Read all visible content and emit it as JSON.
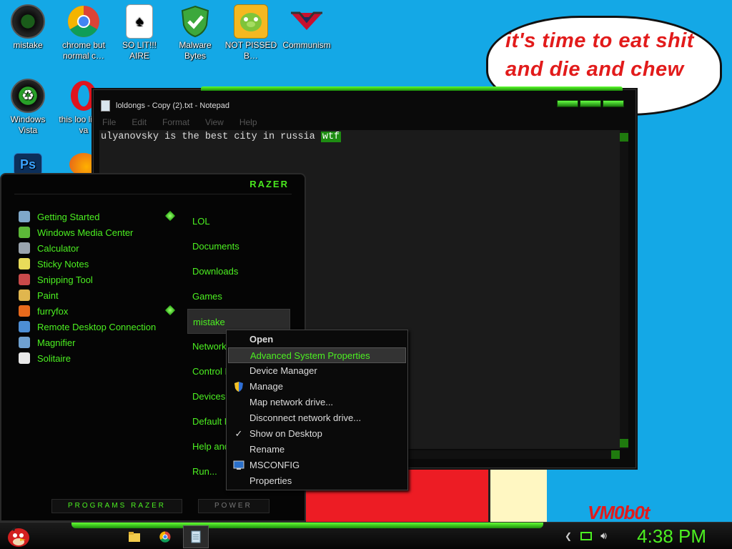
{
  "desktop_icons": [
    {
      "label": "mistake",
      "icon": "razer-icon"
    },
    {
      "label": "chrome but normal c…",
      "icon": "chrome-icon"
    },
    {
      "label": "SO LIT!!! AIRE",
      "icon": "solitaire-icon"
    },
    {
      "label": "Malware Bytes",
      "icon": "shield-icon"
    },
    {
      "label": "NOT PISSED B…",
      "icon": "angry-birds-pig-icon"
    },
    {
      "label": "Communism",
      "icon": "red-emblem-icon"
    },
    {
      "label": "Windows Vista",
      "icon": "recycle-icon"
    },
    {
      "label": "this loo like a va",
      "icon": "opera-icon"
    }
  ],
  "bubble": {
    "text": "it's time to eat shit and die and chew"
  },
  "watermark": "VM0b0t",
  "notepad": {
    "title": "loldongs - Copy (2).txt - Notepad",
    "menu": [
      "File",
      "Edit",
      "Format",
      "View",
      "Help"
    ],
    "text_before": "ulyanovsky is the best city in russia ",
    "text_selected": "wtf"
  },
  "start_menu": {
    "logo": "RAZER",
    "programs": [
      {
        "label": "Getting Started",
        "color": "#7fa8c9",
        "has_arrow": true
      },
      {
        "label": "Windows Media Center",
        "color": "#5cb838",
        "has_arrow": false
      },
      {
        "label": "Calculator",
        "color": "#9aa4ae",
        "has_arrow": false
      },
      {
        "label": "Sticky Notes",
        "color": "#e8dc5a",
        "has_arrow": false
      },
      {
        "label": "Snipping Tool",
        "color": "#c94a4a",
        "has_arrow": false
      },
      {
        "label": "Paint",
        "color": "#e0b64e",
        "has_arrow": false
      },
      {
        "label": "furryfox",
        "color": "#e86a1c",
        "has_arrow": true
      },
      {
        "label": "Remote Desktop Connection",
        "color": "#4d8ed4",
        "has_arrow": false
      },
      {
        "label": "Magnifier",
        "color": "#6fa0d0",
        "has_arrow": false
      },
      {
        "label": "Solitaire",
        "color": "#e8e8e8",
        "has_arrow": false
      }
    ],
    "places": [
      "LOL",
      "Documents",
      "Downloads",
      "Games",
      "mistake",
      "Network",
      "Control P",
      "Devices",
      "Default P",
      "Help and",
      "Run..."
    ],
    "programs_button": "PROGRAMS RAZER",
    "power_button": "POWER"
  },
  "context_menu": [
    {
      "label": "Open",
      "bold": true,
      "icon": ""
    },
    {
      "label": "Advanced System Properties",
      "highlight": true,
      "icon": ""
    },
    {
      "label": "Device Manager",
      "icon": ""
    },
    {
      "label": "Manage",
      "icon": "uac-shield-icon"
    },
    {
      "label": "Map network drive...",
      "icon": ""
    },
    {
      "label": "Disconnect network drive...",
      "icon": ""
    },
    {
      "label": "Show on Desktop",
      "icon": "checkmark-icon"
    },
    {
      "label": "Rename",
      "icon": ""
    },
    {
      "label": "MSCONFIG",
      "icon": "monitor-icon"
    },
    {
      "label": "Properties",
      "icon": ""
    }
  ],
  "taskbar": {
    "clock": "4:38 PM",
    "buttons": [
      "file-explorer-icon",
      "chrome-icon",
      "notepad-icon"
    ]
  },
  "colors": {
    "accent": "#4cf021",
    "desktop": "#14a8e6",
    "bubble_text": "#e21b1b"
  }
}
